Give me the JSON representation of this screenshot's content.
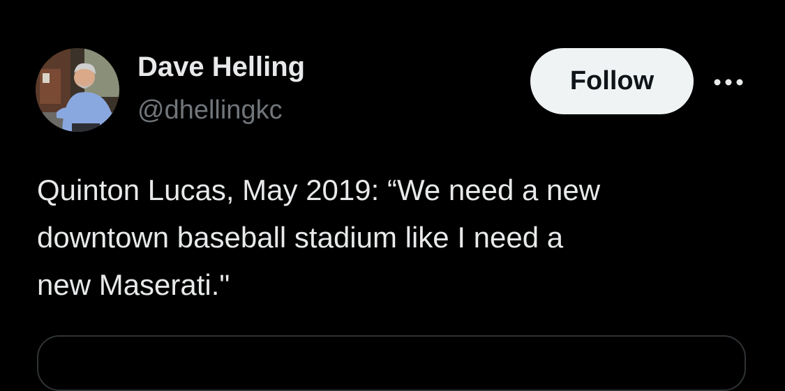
{
  "author": {
    "display_name": "Dave Helling",
    "handle": "@dhellingkc"
  },
  "actions": {
    "follow_label": "Follow",
    "more_icon": "more-horizontal-icon"
  },
  "tweet": {
    "text": "Quinton Lucas, May 2019: “We need a new\ndowntown baseball stadium like I need a\nnew Maserati.\""
  },
  "colors": {
    "background": "#000000",
    "primary_text": "#e7e9ea",
    "secondary_text": "#71767b",
    "follow_button_bg": "#eff3f4",
    "follow_button_text": "#0f1419",
    "border": "#2f3336"
  }
}
